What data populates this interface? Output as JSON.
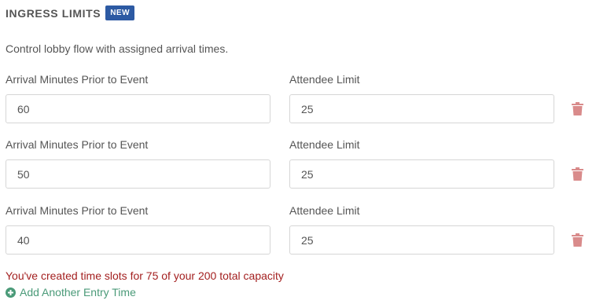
{
  "section": {
    "title": "INGRESS LIMITS",
    "badge": "NEW",
    "description": "Control lobby flow with assigned arrival times."
  },
  "labels": {
    "arrival": "Arrival Minutes Prior to Event",
    "limit": "Attendee Limit"
  },
  "entries": [
    {
      "arrival_minutes": "60",
      "attendee_limit": "25"
    },
    {
      "arrival_minutes": "50",
      "attendee_limit": "25"
    },
    {
      "arrival_minutes": "40",
      "attendee_limit": "25"
    }
  ],
  "capacity_message": "You've created time slots for 75 of your 200 total capacity",
  "add_entry_label": "Add Another Entry Time",
  "icons": {
    "delete": "trash-icon",
    "add": "plus-circle-icon"
  },
  "colors": {
    "badge": "#2d5aa3",
    "trash": "#d98b8b",
    "error_text": "#a31f1f",
    "add_link": "#4a9a78"
  }
}
